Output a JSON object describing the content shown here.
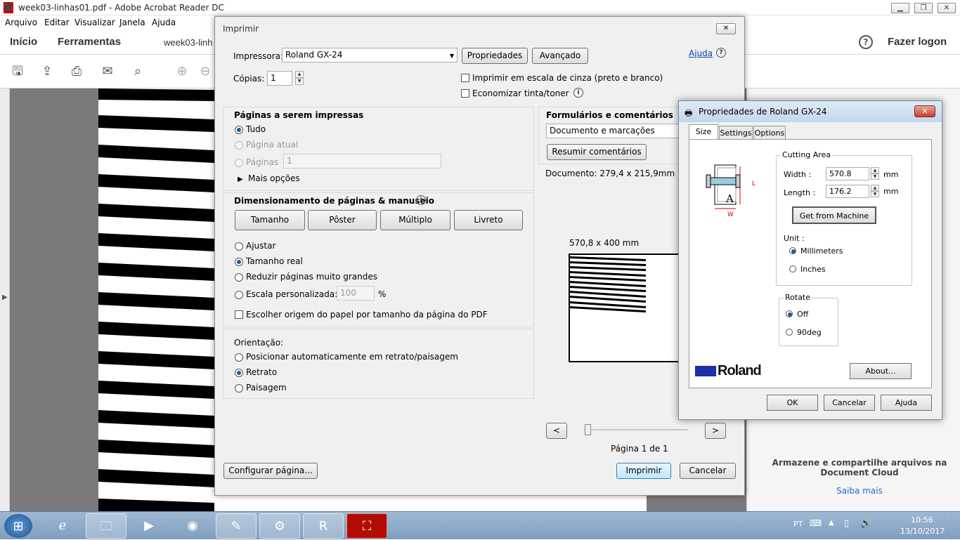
{
  "window": {
    "title": "week03-linhas01.pdf - Adobe Acrobat Reader DC",
    "doc_icon": "pdf-icon"
  },
  "menu": [
    "Arquivo",
    "Editar",
    "Visualizar",
    "Janela",
    "Ajuda"
  ],
  "nav": {
    "home": "Início",
    "tools": "Ferramentas",
    "tab": "week03-linh",
    "login": "Fazer logon",
    "help_icon": "?"
  },
  "side_panel": {
    "cloud_title": "Armazene e compartilhe arquivos na Document Cloud",
    "learn_more": "Saiba mais"
  },
  "print": {
    "title": "Imprimir",
    "printer_label": "Impressora:",
    "printer_value": "Roland GX-24",
    "properties": "Propriedades",
    "advanced": "Avançado",
    "help": "Ajuda",
    "copies_label": "Cópias:",
    "copies_value": "1",
    "grayscale": "Imprimir em escala de cinza (preto e branco)",
    "save_ink": "Economizar tinta/toner",
    "pages_heading": "Páginas a serem impressas",
    "all": "Tudo",
    "current": "Página atual",
    "pages": "Páginas",
    "pages_value": "1",
    "more": "Mais opções",
    "sizing_heading": "Dimensionamento de páginas & manuseio",
    "size_btn": "Tamanho",
    "poster_btn": "Pôster",
    "multiple_btn": "Múltiplo",
    "booklet_btn": "Livreto",
    "fit": "Ajustar",
    "actual": "Tamanho real",
    "shrink": "Reduzir páginas muito grandes",
    "custom": "Escala personalizada:",
    "custom_value": "100",
    "percent": "%",
    "paper_source": "Escolher origem do papel por tamanho da página do PDF",
    "orientation_heading": "Orientação:",
    "auto_orient": "Posicionar automaticamente em retrato/paisagem",
    "portrait": "Retrato",
    "landscape": "Paisagem",
    "forms_heading": "Formulários e comentários",
    "forms_value": "Documento e marcações",
    "summarize": "Resumir comentários",
    "doc_size": "Documento: 279,4 x 215,9mm",
    "preview_size": "570,8 x 400 mm",
    "prev": "<",
    "next": ">",
    "page_of": "Página 1 de 1",
    "page_setup": "Configurar página...",
    "print_btn": "Imprimir",
    "cancel_btn": "Cancelar"
  },
  "roland": {
    "title": "Propriedades de Roland GX-24",
    "tabs": [
      "Size",
      "Settings",
      "Options"
    ],
    "cutting_area": "Cutting Area",
    "width_label": "Width :",
    "width_value": "570.8",
    "length_label": "Length :",
    "length_value": "176.2",
    "unit_mm": "mm",
    "get_from_machine": "Get from Machine",
    "unit_label": "Unit :",
    "millimeters": "Millimeters",
    "inches": "Inches",
    "rotate": "Rotate",
    "off": "Off",
    "deg90": "90deg",
    "brand": "Roland",
    "about": "About...",
    "ok": "OK",
    "cancel": "Cancelar",
    "help": "Ajuda",
    "diagram_l": "L",
    "diagram_w": "W",
    "diagram_a": "A"
  },
  "taskbar": {
    "lang": "PT",
    "time": "10:56",
    "date": "13/10/2017"
  },
  "colors": {
    "accent": "#1a5aa8",
    "link": "#0645ad",
    "roland_blue": "#1b2fa8",
    "close_red": "#c2412b"
  }
}
